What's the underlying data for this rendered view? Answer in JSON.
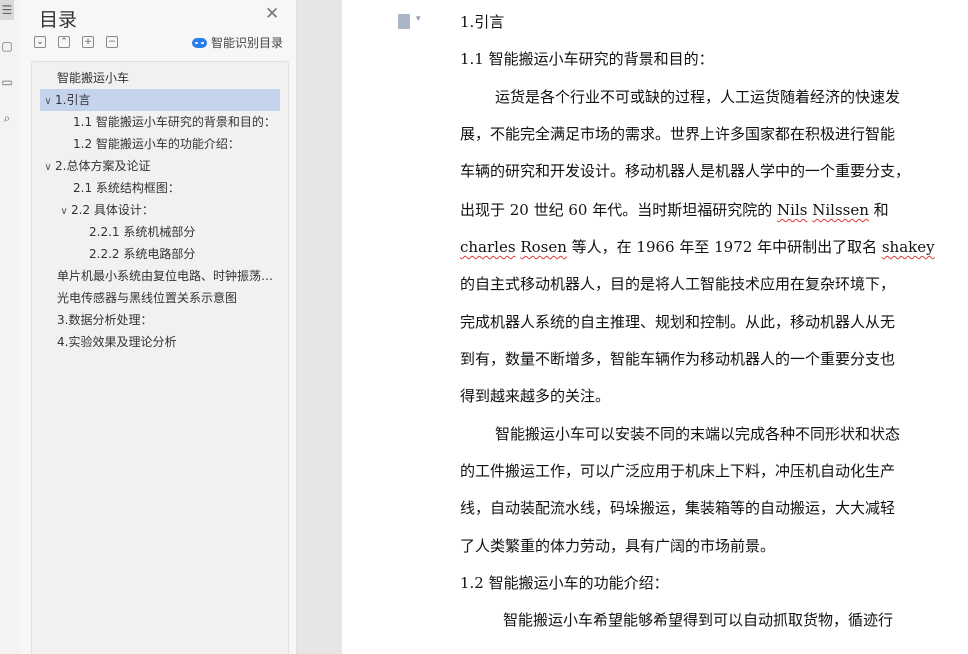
{
  "toc": {
    "title": "目录",
    "smart_label": "智能识别目录",
    "items": [
      {
        "label": "智能搬运小车"
      },
      {
        "label": "1.引言"
      },
      {
        "label": "1.1 智能搬运小车研究的背景和目的："
      },
      {
        "label": "1.2 智能搬运小车的功能介绍："
      },
      {
        "label": "2.总体方案及论证"
      },
      {
        "label": "2.1 系统结构框图："
      },
      {
        "label": "2.2 具体设计："
      },
      {
        "label": "2.2.1 系统机械部分"
      },
      {
        "label": "2.2.2 系统电路部分"
      },
      {
        "label": "单片机最小系统由复位电路、时钟振荡电路组成"
      },
      {
        "label": "光电传感器与黑线位置关系示意图"
      },
      {
        "label": "3.数据分析处理："
      },
      {
        "label": "4.实验效果及理论分析"
      }
    ]
  },
  "document": {
    "lines": [
      {
        "text": "1.引言"
      },
      {
        "text": "1.1 智能搬运小车研究的背景和目的："
      },
      {
        "text": "运货是各个行业不可或缺的过程，人工运货随着经济的快速发"
      },
      {
        "text": "展，不能完全满足市场的需求。世界上许多国家都在积极进行智能"
      },
      {
        "text": "车辆的研究和开发设计。移动机器人是机器人学中的一个重要分支，"
      },
      {
        "pre": "出现于 20 世纪 60 年代。当时斯坦福研究院的 ",
        "w1": "Nils",
        "mid": " ",
        "w2": "Nilssen",
        "post": " 和"
      },
      {
        "w1": "charles",
        "mid": " ",
        "w2": "Rosen",
        "pre2": " 等人，在 1966 年至 1972 年中研制出了取名 ",
        "w3": "shakey"
      },
      {
        "text": "的自主式移动机器人，目的是将人工智能技术应用在复杂环境下，"
      },
      {
        "text": "完成机器人系统的自主推理、规划和控制。从此，移动机器人从无"
      },
      {
        "text": "到有，数量不断增多，智能车辆作为移动机器人的一个重要分支也"
      },
      {
        "text": "得到越来越多的关注。"
      },
      {
        "text": "智能搬运小车可以安装不同的末端以完成各种不同形状和状态"
      },
      {
        "text": "的工件搬运工作，可以广泛应用于机床上下料，冲压机自动化生产"
      },
      {
        "text": "线，自动装配流水线，码垛搬运，集装箱等的自动搬运，大大减轻"
      },
      {
        "text": "了人类繁重的体力劳动，具有广阔的市场前景。"
      },
      {
        "text": "1.2 智能搬运小车的功能介绍："
      },
      {
        "text": "智能搬运小车希望能够希望得到可以自动抓取货物，循迹行"
      }
    ]
  },
  "icons": {
    "toc_close": "close-icon",
    "collapse_all": "collapse-all-icon",
    "expand_all": "expand-all-icon",
    "add_level": "add-level-icon",
    "remove_level": "remove-level-icon",
    "smart": "ai-cloud-icon",
    "page_menu": "page-icon"
  }
}
